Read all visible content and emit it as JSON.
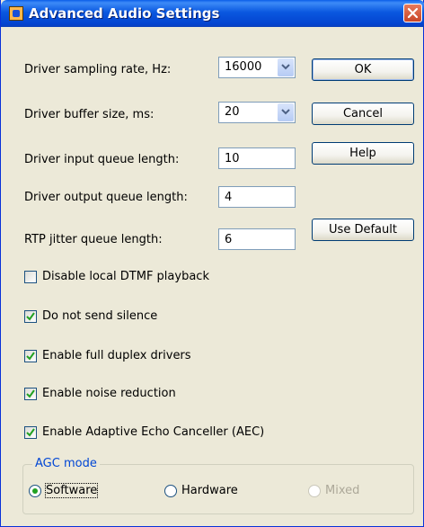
{
  "window": {
    "title": "Advanced Audio Settings",
    "icon": "app-icon",
    "close_icon": "close-icon"
  },
  "fields": {
    "sampling_rate": {
      "label": "Driver sampling rate, Hz:",
      "value": "16000"
    },
    "buffer_size": {
      "label": "Driver buffer size, ms:",
      "value": "20"
    },
    "input_queue": {
      "label": "Driver input queue length:",
      "value": "10"
    },
    "output_queue": {
      "label": "Driver output queue length:",
      "value": "4"
    },
    "jitter_queue": {
      "label": "RTP jitter queue length:",
      "value": "6"
    }
  },
  "buttons": {
    "ok": "OK",
    "cancel": "Cancel",
    "help": "Help",
    "use_default": "Use Default"
  },
  "checkboxes": [
    {
      "label": "Disable local DTMF playback",
      "checked": false
    },
    {
      "label": "Do not send silence",
      "checked": true
    },
    {
      "label": "Enable full duplex drivers",
      "checked": true
    },
    {
      "label": "Enable noise reduction",
      "checked": true
    },
    {
      "label": "Enable Adaptive Echo Canceller (AEC)",
      "checked": true
    }
  ],
  "agc": {
    "title": "AGC mode",
    "options": [
      {
        "label": "Software",
        "selected": true,
        "enabled": true
      },
      {
        "label": "Hardware",
        "selected": false,
        "enabled": true
      },
      {
        "label": "Mixed",
        "selected": false,
        "enabled": false
      }
    ]
  },
  "colors": {
    "titlebar": "#0a58e0",
    "dialog_bg": "#ece9d8",
    "check_mark": "#21a121",
    "group_title": "#0046d5"
  }
}
